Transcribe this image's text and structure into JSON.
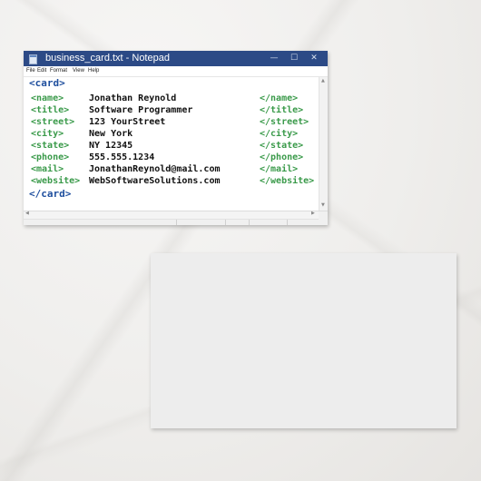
{
  "window": {
    "title": "business_card.txt - Notepad",
    "controls": {
      "minimize": "—",
      "maximize": "☐",
      "close": "✕"
    }
  },
  "menu": [
    "File",
    "Edit",
    "Format",
    "View",
    "Help"
  ],
  "document": {
    "open_tag": "<card>",
    "close_tag": "</card>",
    "lines": [
      {
        "open": "<name>",
        "value": "Jonathan Reynold",
        "close": "</name>"
      },
      {
        "open": "<title>",
        "value": "Software Programmer",
        "close": "</title>"
      },
      {
        "open": "<street>",
        "value": "123 YourStreet",
        "close": "</street>"
      },
      {
        "open": "<city>",
        "value": "New York",
        "close": "</city>"
      },
      {
        "open": "<state>",
        "value": "NY 12345",
        "close": "</state>"
      },
      {
        "open": "<phone>",
        "value": "555.555.1234",
        "close": "</phone>"
      },
      {
        "open": "<mail>",
        "value": "JonathanReynold@mail.com",
        "close": "</mail>"
      },
      {
        "open": "<website>",
        "value": "WebSoftwareSolutions.com",
        "close": "</website>"
      }
    ]
  },
  "colors": {
    "titlebar": "#2c4a86",
    "root_tag": "#1f4f9e",
    "tag": "#3a9a4a",
    "value": "#111111",
    "back_card": "#ededed"
  }
}
